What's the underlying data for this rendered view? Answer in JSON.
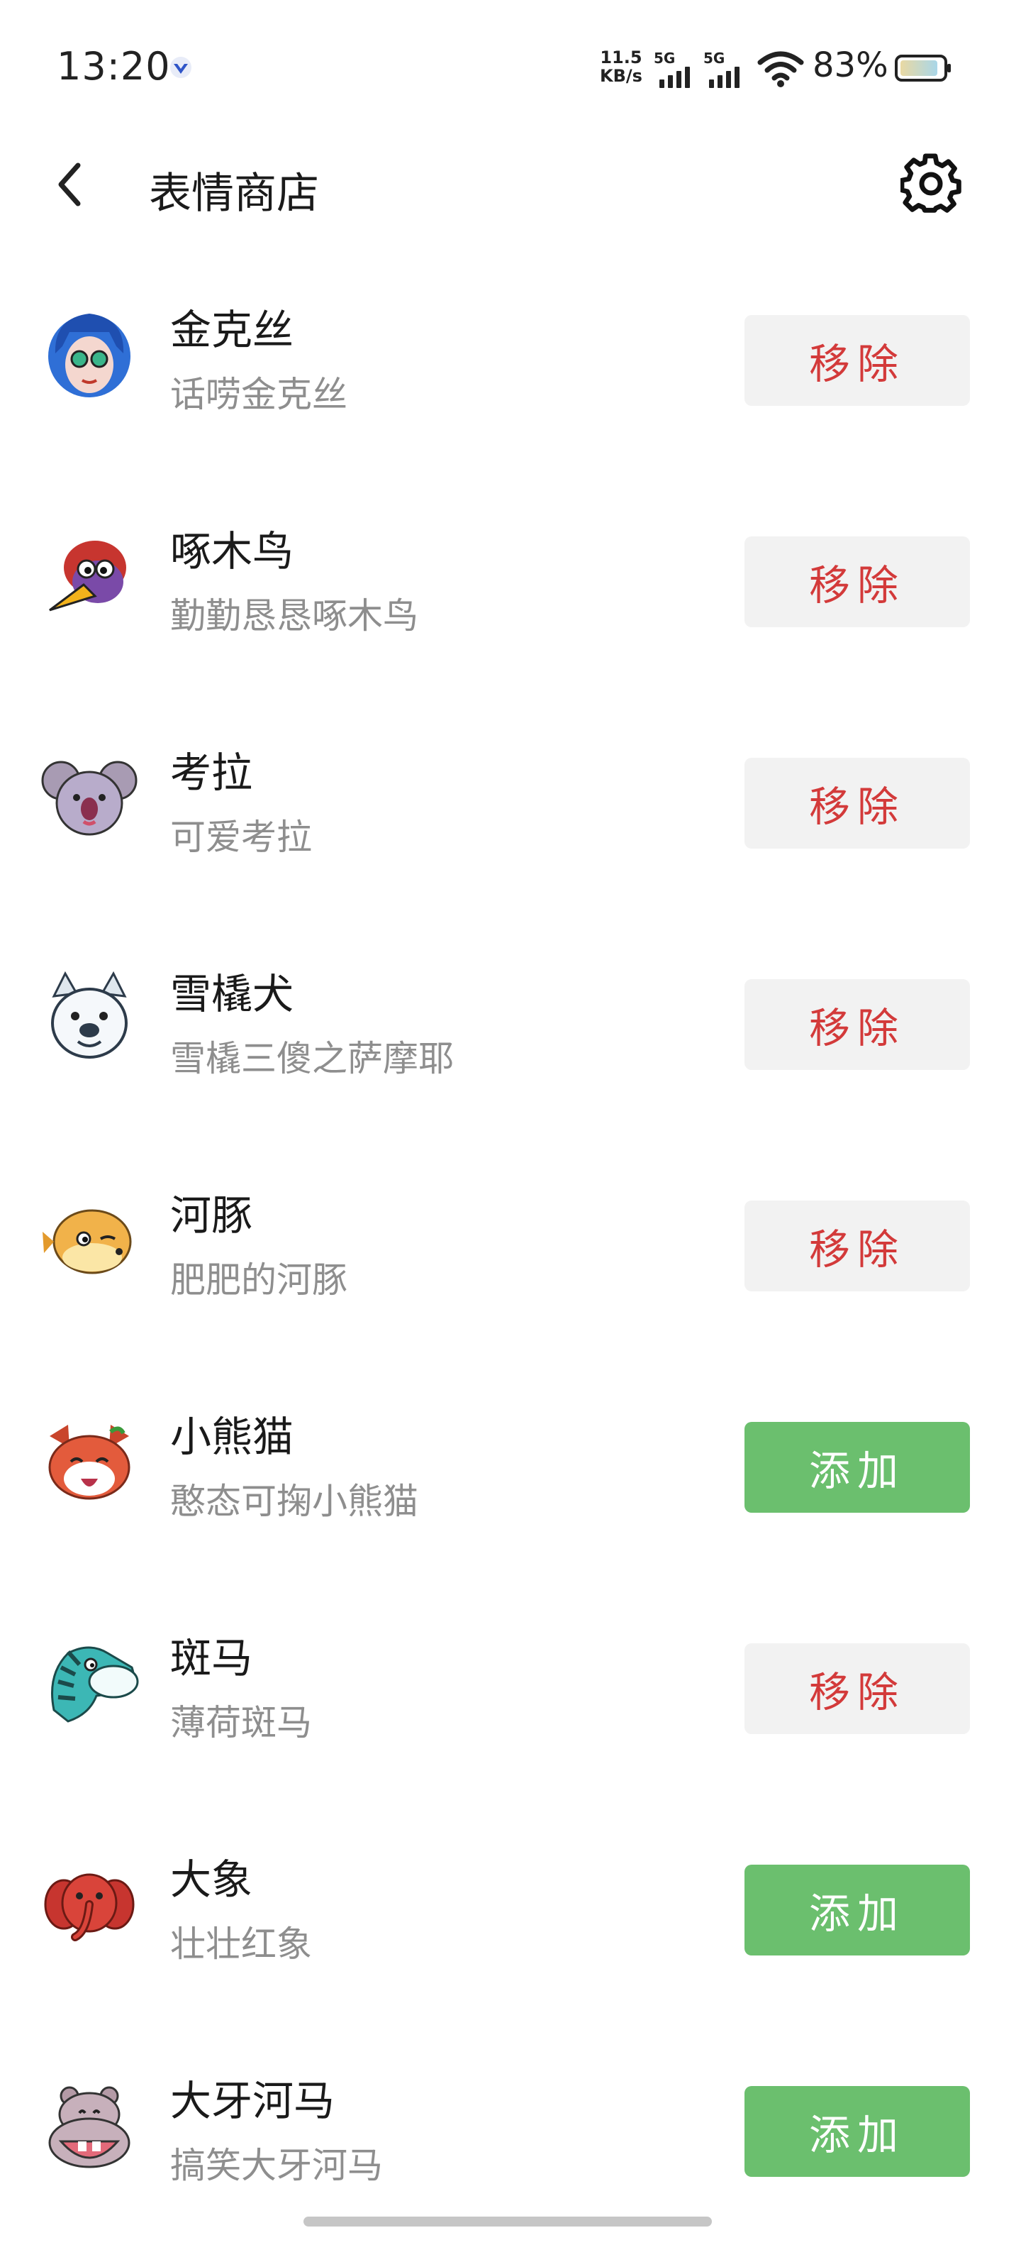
{
  "status_bar": {
    "time": "13:20",
    "net_speed_value": "11.5",
    "net_speed_unit": "KB/s",
    "signal_1": "5G",
    "signal_2": "5G",
    "battery_percent": "83%"
  },
  "header": {
    "title": "表情商店",
    "back_icon": "chevron-left-icon",
    "settings_icon": "gear-icon"
  },
  "stickers": [
    {
      "name": "金克丝",
      "desc": "话唠金克丝",
      "action": "移除",
      "state": "remove",
      "icon": "jinx-avatar"
    },
    {
      "name": "啄木鸟",
      "desc": "勤勤恳恳啄木鸟",
      "action": "移除",
      "state": "remove",
      "icon": "woodpecker-avatar"
    },
    {
      "name": "考拉",
      "desc": "可爱考拉",
      "action": "移除",
      "state": "remove",
      "icon": "koala-avatar"
    },
    {
      "name": "雪橇犬",
      "desc": "雪橇三傻之萨摩耶",
      "action": "移除",
      "state": "remove",
      "icon": "husky-avatar"
    },
    {
      "name": "河豚",
      "desc": "肥肥的河豚",
      "action": "移除",
      "state": "remove",
      "icon": "pufferfish-avatar"
    },
    {
      "name": "小熊猫",
      "desc": "憨态可掬小熊猫",
      "action": "添加",
      "state": "add",
      "icon": "red-panda-avatar"
    },
    {
      "name": "斑马",
      "desc": "薄荷斑马",
      "action": "移除",
      "state": "remove",
      "icon": "zebra-avatar"
    },
    {
      "name": "大象",
      "desc": "壮壮红象",
      "action": "添加",
      "state": "add",
      "icon": "elephant-avatar"
    },
    {
      "name": "大牙河马",
      "desc": "搞笑大牙河马",
      "action": "添加",
      "state": "add",
      "icon": "hippo-avatar"
    }
  ],
  "colors": {
    "remove_text": "#d33a3a",
    "remove_bg": "#f2f2f2",
    "add_bg": "#6bbf6e",
    "add_text": "#ffffff"
  }
}
